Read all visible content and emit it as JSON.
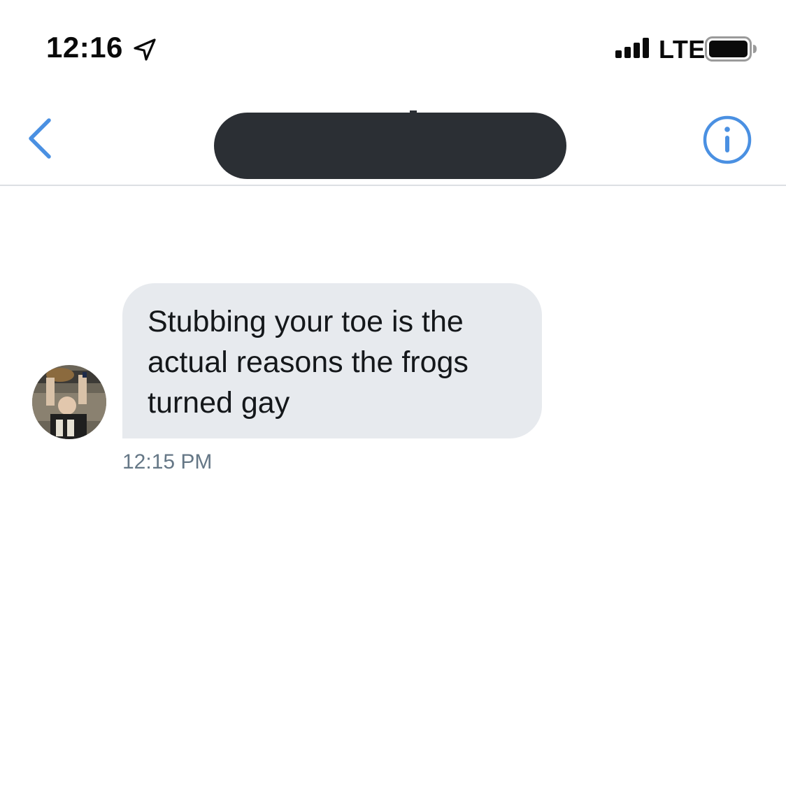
{
  "status_bar": {
    "time": "12:16",
    "network": "LTE",
    "icons": [
      "location-arrow-icon",
      "signal-bars-icon",
      "battery-icon"
    ]
  },
  "nav": {
    "back_icon": "chevron-left-icon",
    "info_icon": "info-circle-icon",
    "accent_color": "#4a90e2"
  },
  "conversation": {
    "messages": [
      {
        "text": "Stubbing your toe is the actual reasons the frogs turned gay",
        "time": "12:15 PM",
        "bubble_color": "#e7eaee"
      }
    ]
  }
}
